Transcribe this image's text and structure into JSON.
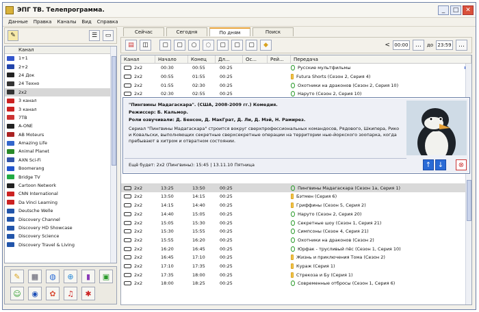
{
  "app": {
    "title": "ЭПГ ТВ. Телепрограмма."
  },
  "window_buttons": {
    "minimize": "_",
    "maximize": "□",
    "close": "✕"
  },
  "menu": [
    "Данные",
    "Правка",
    "Каналы",
    "Вид",
    "Справка"
  ],
  "channels": {
    "header": "Канал",
    "items": [
      {
        "name": "1+1",
        "color": "#3355cc"
      },
      {
        "name": "2+2",
        "color": "#2244aa"
      },
      {
        "name": "24 Док",
        "color": "#222222"
      },
      {
        "name": "24 Техно",
        "color": "#333333"
      },
      {
        "name": "2х2",
        "color": "#333333",
        "selected": true
      },
      {
        "name": "3 канал",
        "color": "#cc2222"
      },
      {
        "name": "3 канал",
        "color": "#cc2222"
      },
      {
        "name": "7ТВ",
        "color": "#cc3333"
      },
      {
        "name": "A-ONE",
        "color": "#222222"
      },
      {
        "name": "AB Moteurs",
        "color": "#aa2222"
      },
      {
        "name": "Amazing Life",
        "color": "#3366cc"
      },
      {
        "name": "Animal Planet",
        "color": "#2a8a2a"
      },
      {
        "name": "AXN Sci-Fi",
        "color": "#3355aa"
      },
      {
        "name": "Boomerang",
        "color": "#2255cc"
      },
      {
        "name": "Bridge TV",
        "color": "#22aa44"
      },
      {
        "name": "Cartoon Network",
        "color": "#222222"
      },
      {
        "name": "CNN International",
        "color": "#cc2222"
      },
      {
        "name": "Da Vinci Learning",
        "color": "#cc2222"
      },
      {
        "name": "Deutsche Welle",
        "color": "#2255aa"
      },
      {
        "name": "Discovery Channel",
        "color": "#2255aa"
      },
      {
        "name": "Discovery HD Showcase",
        "color": "#2255aa"
      },
      {
        "name": "Discovery Science",
        "color": "#2255aa"
      },
      {
        "name": "Discovery Travel & Living",
        "color": "#2255aa"
      }
    ]
  },
  "tabs": [
    "Сейчас",
    "Сегодня",
    "По дням",
    "Поиск"
  ],
  "active_tab": 2,
  "time_filter": {
    "from": "00:00",
    "to": "23:59",
    "lt": "<",
    "sep": "до"
  },
  "grid": {
    "headers": [
      "Канал",
      "Начало",
      "Конец",
      "Дл...",
      "Ос...",
      "Рей...",
      "Передача"
    ],
    "rows_top": [
      {
        "ch": "2х2",
        "start": "00:30",
        "end": "00:55",
        "dur": "00:25",
        "title": "Русские мультфильмы",
        "mark": "g",
        "tail": true
      },
      {
        "ch": "2х2",
        "start": "00:55",
        "end": "01:55",
        "dur": "00:25",
        "title": "Futura Shorts (Сезон 2, Серия 4)",
        "mark": "o"
      },
      {
        "ch": "2х2",
        "start": "01:55",
        "end": "02:30",
        "dur": "00:25",
        "title": "Охотники на драконов (Сезон 2, Серия 10)",
        "mark": "g"
      },
      {
        "ch": "2х2",
        "start": "02:30",
        "end": "02:55",
        "dur": "00:25",
        "title": "Наруто (Сезон 2, Серия 10)",
        "mark": "g"
      },
      {
        "ch": "2х2",
        "start": "02:55",
        "end": "03:20",
        "dur": "00:25",
        "title": "Футурама (Сезон 1, Серия 10)",
        "mark": "g"
      }
    ],
    "rows_bottom": [
      {
        "ch": "2х2",
        "start": "13:25",
        "end": "13:50",
        "dur": "00:25",
        "title": "Пингвины Мадагаскара (Сезон 1а, Серия 1)",
        "mark": "g",
        "sel": true
      },
      {
        "ch": "2х2",
        "start": "13:50",
        "end": "14:15",
        "dur": "00:25",
        "title": "Бэтмен (Серия 6)",
        "mark": "o"
      },
      {
        "ch": "2х2",
        "start": "14:15",
        "end": "14:40",
        "dur": "00:25",
        "title": "Гриффины (Сезон 5, Серия 2)",
        "mark": "o"
      },
      {
        "ch": "2х2",
        "start": "14:40",
        "end": "15:05",
        "dur": "00:25",
        "title": "Наруто (Сезон 2, Серия 20)",
        "mark": "g"
      },
      {
        "ch": "2х2",
        "start": "15:05",
        "end": "15:30",
        "dur": "00:25",
        "title": "Секретные шоу (Сезон 1, Серия 21)",
        "mark": "g"
      },
      {
        "ch": "2х2",
        "start": "15:30",
        "end": "15:55",
        "dur": "00:25",
        "title": "Симпсоны (Сезон 4, Серия 21)",
        "mark": "g"
      },
      {
        "ch": "2х2",
        "start": "15:55",
        "end": "16:20",
        "dur": "00:25",
        "title": "Охотники на драконов (Сезон 2)",
        "mark": "g"
      },
      {
        "ch": "2х2",
        "start": "16:20",
        "end": "16:45",
        "dur": "00:25",
        "title": "Юрфак - трусливый пёс (Сезон 1, Серия 10)",
        "mark": "g"
      },
      {
        "ch": "2х2",
        "start": "16:45",
        "end": "17:10",
        "dur": "00:25",
        "title": "Жизнь и приключения Тома (Сезон 2)",
        "mark": "o"
      },
      {
        "ch": "2х2",
        "start": "17:10",
        "end": "17:35",
        "dur": "00:25",
        "title": "Кураж (Серия 1)",
        "mark": "o"
      },
      {
        "ch": "2х2",
        "start": "17:35",
        "end": "18:00",
        "dur": "00:25",
        "title": "Стрекоза и Бу (Серия 1)",
        "mark": "o"
      },
      {
        "ch": "2х2",
        "start": "18:00",
        "end": "18:25",
        "dur": "00:25",
        "title": "Современные отбросы (Сезон 1, Серия 6)",
        "mark": "g"
      }
    ]
  },
  "detail": {
    "title": "\"Пингвины Мадагаскара\". (США, 2008-2009 гг.) Комедия.",
    "director": "Режиссер: Б. Кальмор.",
    "voices": "Роли озвучивали: Д. Бенсон, Д. МакГрат, Д. Ли, Д. Мэй, Н. Рамирез.",
    "synopsis": "Сериал \"Пингвины Мадагаскара\" строится вокруг сверхпрофессиональных командосов, Рядового, Шкипера, Рико и Ковальски, выполняющих секретные сверхсекретные операции на территории нью-йоркского зоопарка, когда пребывают в хитром и отвратном состоянии.",
    "footer": "Ещё будет: 2х2 (Пингвины): 15:45 | 13.11.10 Пятница",
    "up": "↑",
    "down": "↓",
    "close": "⊗"
  }
}
